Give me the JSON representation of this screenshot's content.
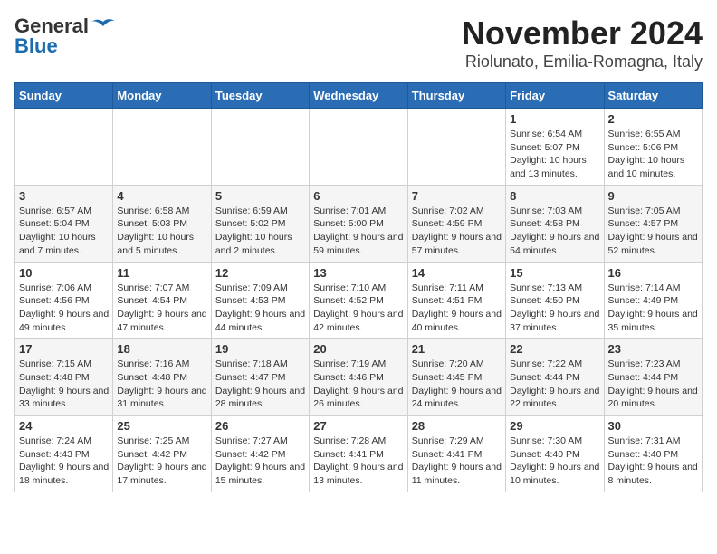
{
  "logo": {
    "general": "General",
    "blue": "Blue"
  },
  "title": "November 2024",
  "subtitle": "Riolunato, Emilia-Romagna, Italy",
  "days_header": [
    "Sunday",
    "Monday",
    "Tuesday",
    "Wednesday",
    "Thursday",
    "Friday",
    "Saturday"
  ],
  "weeks": [
    [
      {
        "day": "",
        "info": ""
      },
      {
        "day": "",
        "info": ""
      },
      {
        "day": "",
        "info": ""
      },
      {
        "day": "",
        "info": ""
      },
      {
        "day": "",
        "info": ""
      },
      {
        "day": "1",
        "info": "Sunrise: 6:54 AM\nSunset: 5:07 PM\nDaylight: 10 hours and 13 minutes."
      },
      {
        "day": "2",
        "info": "Sunrise: 6:55 AM\nSunset: 5:06 PM\nDaylight: 10 hours and 10 minutes."
      }
    ],
    [
      {
        "day": "3",
        "info": "Sunrise: 6:57 AM\nSunset: 5:04 PM\nDaylight: 10 hours and 7 minutes."
      },
      {
        "day": "4",
        "info": "Sunrise: 6:58 AM\nSunset: 5:03 PM\nDaylight: 10 hours and 5 minutes."
      },
      {
        "day": "5",
        "info": "Sunrise: 6:59 AM\nSunset: 5:02 PM\nDaylight: 10 hours and 2 minutes."
      },
      {
        "day": "6",
        "info": "Sunrise: 7:01 AM\nSunset: 5:00 PM\nDaylight: 9 hours and 59 minutes."
      },
      {
        "day": "7",
        "info": "Sunrise: 7:02 AM\nSunset: 4:59 PM\nDaylight: 9 hours and 57 minutes."
      },
      {
        "day": "8",
        "info": "Sunrise: 7:03 AM\nSunset: 4:58 PM\nDaylight: 9 hours and 54 minutes."
      },
      {
        "day": "9",
        "info": "Sunrise: 7:05 AM\nSunset: 4:57 PM\nDaylight: 9 hours and 52 minutes."
      }
    ],
    [
      {
        "day": "10",
        "info": "Sunrise: 7:06 AM\nSunset: 4:56 PM\nDaylight: 9 hours and 49 minutes."
      },
      {
        "day": "11",
        "info": "Sunrise: 7:07 AM\nSunset: 4:54 PM\nDaylight: 9 hours and 47 minutes."
      },
      {
        "day": "12",
        "info": "Sunrise: 7:09 AM\nSunset: 4:53 PM\nDaylight: 9 hours and 44 minutes."
      },
      {
        "day": "13",
        "info": "Sunrise: 7:10 AM\nSunset: 4:52 PM\nDaylight: 9 hours and 42 minutes."
      },
      {
        "day": "14",
        "info": "Sunrise: 7:11 AM\nSunset: 4:51 PM\nDaylight: 9 hours and 40 minutes."
      },
      {
        "day": "15",
        "info": "Sunrise: 7:13 AM\nSunset: 4:50 PM\nDaylight: 9 hours and 37 minutes."
      },
      {
        "day": "16",
        "info": "Sunrise: 7:14 AM\nSunset: 4:49 PM\nDaylight: 9 hours and 35 minutes."
      }
    ],
    [
      {
        "day": "17",
        "info": "Sunrise: 7:15 AM\nSunset: 4:48 PM\nDaylight: 9 hours and 33 minutes."
      },
      {
        "day": "18",
        "info": "Sunrise: 7:16 AM\nSunset: 4:48 PM\nDaylight: 9 hours and 31 minutes."
      },
      {
        "day": "19",
        "info": "Sunrise: 7:18 AM\nSunset: 4:47 PM\nDaylight: 9 hours and 28 minutes."
      },
      {
        "day": "20",
        "info": "Sunrise: 7:19 AM\nSunset: 4:46 PM\nDaylight: 9 hours and 26 minutes."
      },
      {
        "day": "21",
        "info": "Sunrise: 7:20 AM\nSunset: 4:45 PM\nDaylight: 9 hours and 24 minutes."
      },
      {
        "day": "22",
        "info": "Sunrise: 7:22 AM\nSunset: 4:44 PM\nDaylight: 9 hours and 22 minutes."
      },
      {
        "day": "23",
        "info": "Sunrise: 7:23 AM\nSunset: 4:44 PM\nDaylight: 9 hours and 20 minutes."
      }
    ],
    [
      {
        "day": "24",
        "info": "Sunrise: 7:24 AM\nSunset: 4:43 PM\nDaylight: 9 hours and 18 minutes."
      },
      {
        "day": "25",
        "info": "Sunrise: 7:25 AM\nSunset: 4:42 PM\nDaylight: 9 hours and 17 minutes."
      },
      {
        "day": "26",
        "info": "Sunrise: 7:27 AM\nSunset: 4:42 PM\nDaylight: 9 hours and 15 minutes."
      },
      {
        "day": "27",
        "info": "Sunrise: 7:28 AM\nSunset: 4:41 PM\nDaylight: 9 hours and 13 minutes."
      },
      {
        "day": "28",
        "info": "Sunrise: 7:29 AM\nSunset: 4:41 PM\nDaylight: 9 hours and 11 minutes."
      },
      {
        "day": "29",
        "info": "Sunrise: 7:30 AM\nSunset: 4:40 PM\nDaylight: 9 hours and 10 minutes."
      },
      {
        "day": "30",
        "info": "Sunrise: 7:31 AM\nSunset: 4:40 PM\nDaylight: 9 hours and 8 minutes."
      }
    ]
  ]
}
